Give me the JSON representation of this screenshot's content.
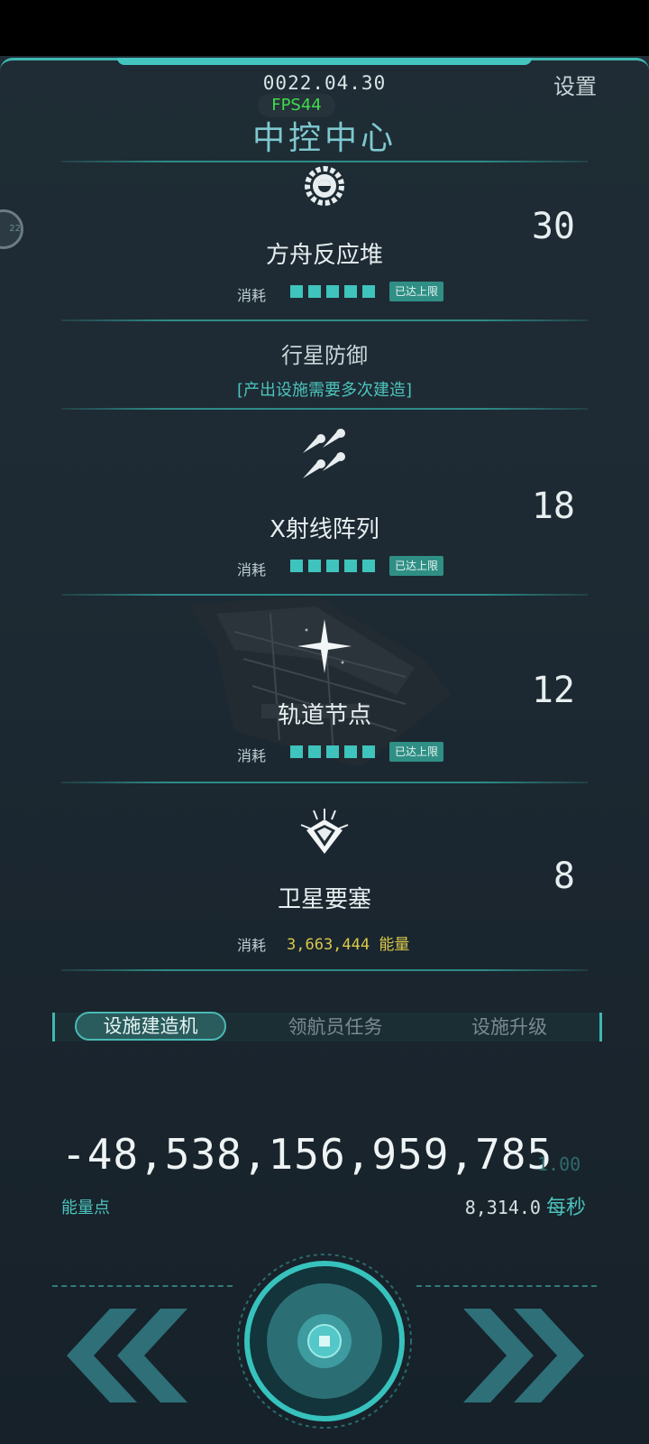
{
  "header": {
    "date": "0022.04.30",
    "settings_label": "设置",
    "fps_label": "FPS44",
    "title": "中控中心"
  },
  "side_badge": {
    "label": "22"
  },
  "facilities": [
    {
      "name": "方舟反应堆",
      "count": "30",
      "icon": "gear-reactor-icon",
      "consume_label": "消耗",
      "level": 5,
      "badge": "已达上限"
    },
    {
      "name": "X射线阵列",
      "count": "18",
      "icon": "x-ray-array-icon",
      "consume_label": "消耗",
      "level": 5,
      "badge": "已达上限"
    },
    {
      "name": "轨道节点",
      "count": "12",
      "icon": "star-node-icon",
      "consume_label": "消耗",
      "level": 5,
      "badge": "已达上限"
    },
    {
      "name": "卫星要塞",
      "count": "8",
      "icon": "satellite-fortress-icon",
      "consume_label": "消耗",
      "cost": "3,663,444 能量"
    }
  ],
  "section": {
    "title": "行星防御",
    "note": "[产出设施需要多次建造]"
  },
  "tabs": [
    {
      "label": "设施建造机",
      "active": true
    },
    {
      "label": "领航员任务",
      "active": false
    },
    {
      "label": "设施升级",
      "active": false
    }
  ],
  "energy": {
    "value": "-48,538,156,959,785",
    "multiplier": "1.00",
    "label": "能量点",
    "rate": "8,314.0",
    "rate_unit": "每秒"
  },
  "colors": {
    "accent": "#3fb7b1",
    "badge": "#2f8f85",
    "cost": "#d9c94a",
    "fps": "#3fdc4e"
  },
  "controls": {
    "left": "double-chevron-left-icon",
    "center": "core-button-icon",
    "right": "double-chevron-right-icon"
  }
}
